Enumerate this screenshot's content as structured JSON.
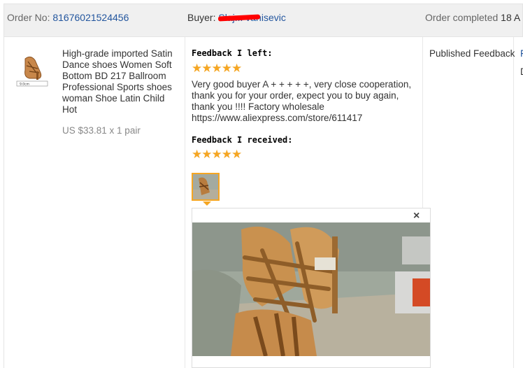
{
  "header": {
    "order_label": "Order No:",
    "order_number": "81676021524456",
    "buyer_label": "Buyer:",
    "buyer_name_visible": "Slaj... vanisevic",
    "status": "Order completed",
    "status_date_partial": "18 A"
  },
  "product": {
    "image_label": "9.0cm",
    "title": "High-grade imported Satin Dance shoes Women Soft Bottom BD 217 Ballroom Professional Sports shoes woman Shoe Latin Child Hot",
    "price": "US $33.81 x 1 pair"
  },
  "feedback": {
    "left_heading": "Feedback I left:",
    "left_stars": "★★★★★",
    "left_text": "Very good buyer A + + + + +, very close cooperation, thank you for your order, expect you to buy again, thank you !!!! Factory wholesale https://www.aliexpress.com/store/611417",
    "received_heading": "Feedback I received:",
    "received_stars": "★★★★★",
    "close_glyph": "×"
  },
  "status_column": {
    "status_text": "Published Feedback",
    "edge_link": "F",
    "edge_text": "D"
  },
  "icons": [
    "close-icon",
    "star-icon"
  ],
  "colors": {
    "link": "#23569e",
    "star": "#f5a623",
    "header_bg": "#f0f0f0"
  }
}
